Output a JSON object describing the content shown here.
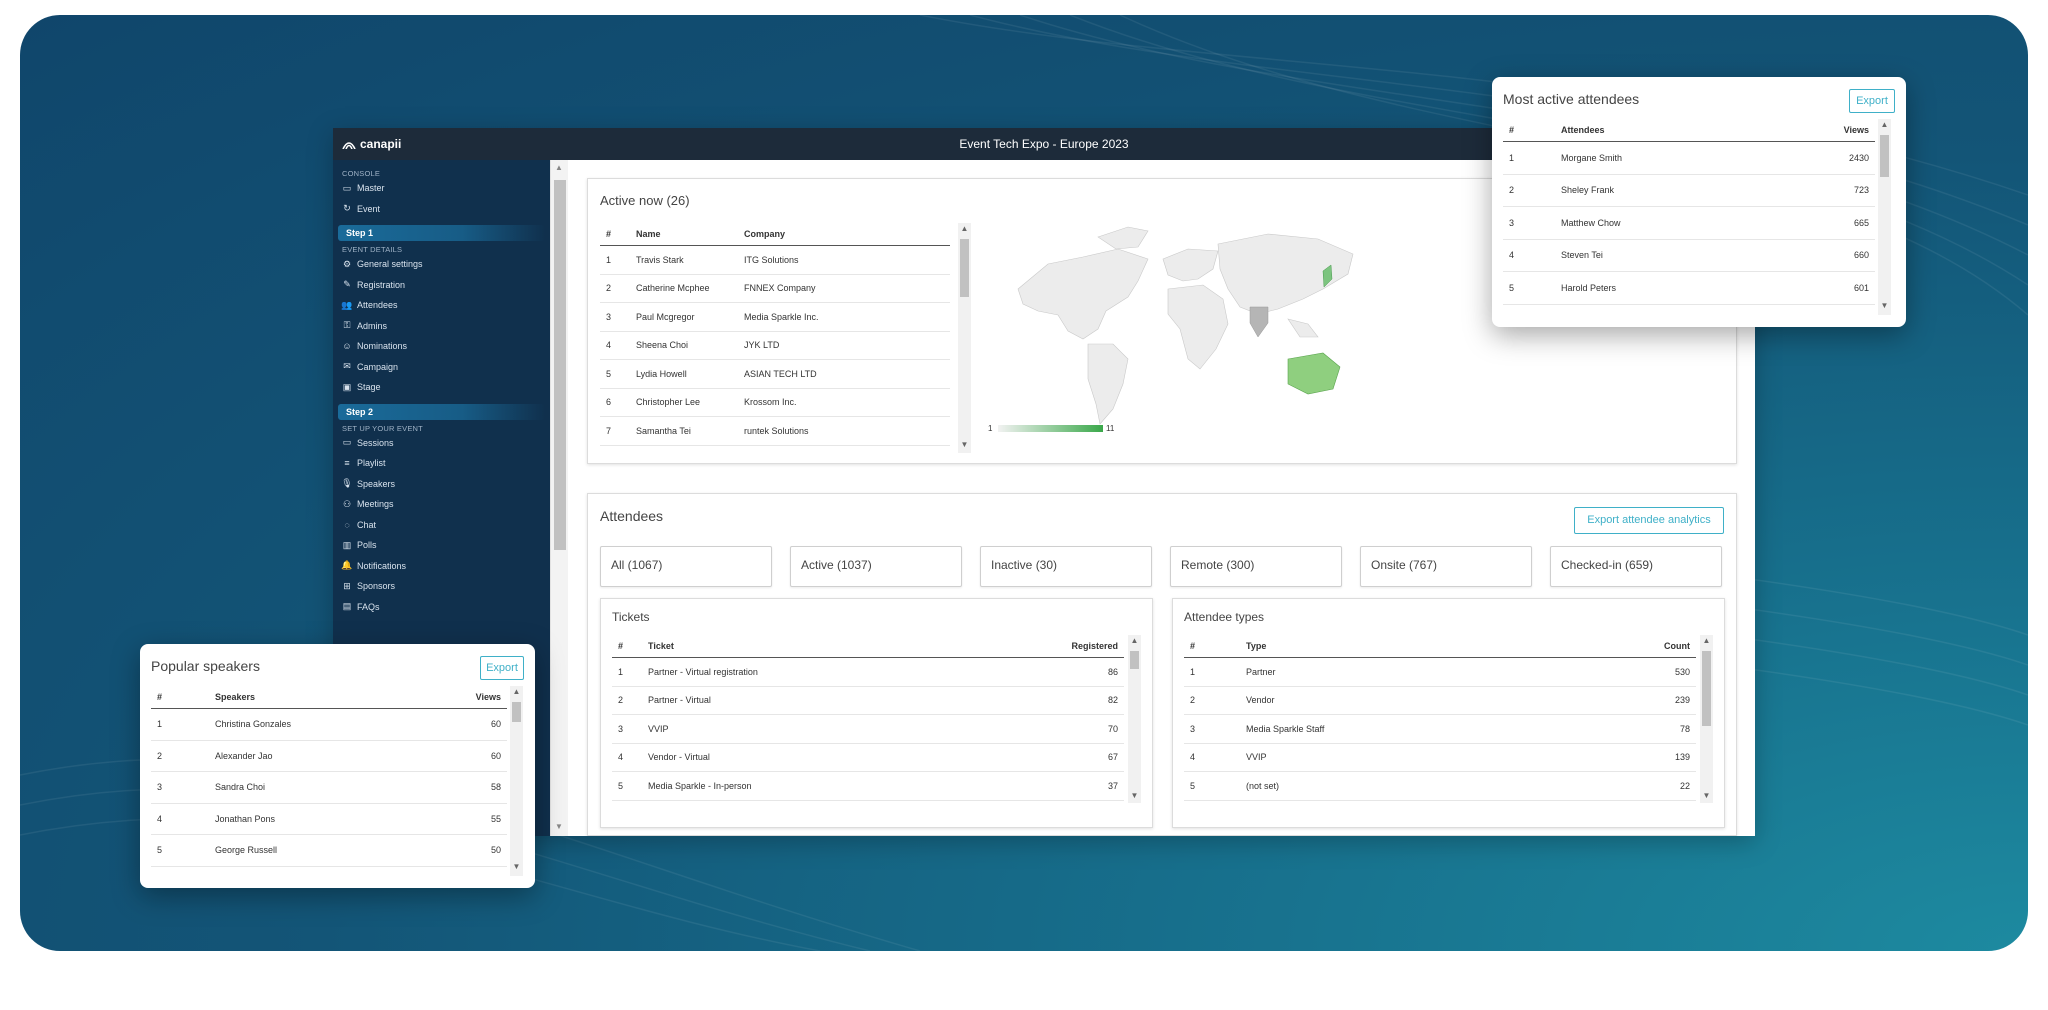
{
  "app": {
    "brand": "canapii",
    "title": "Event Tech Expo - Europe 2023"
  },
  "sidebar": {
    "console_label": "CONSOLE",
    "console_items": [
      {
        "label": "Master",
        "icon": "calendar-icon"
      },
      {
        "label": "Event",
        "icon": "event-icon"
      }
    ],
    "step1": "Step 1",
    "event_details_label": "EVENT DETAILS",
    "step1_items": [
      {
        "label": "General settings",
        "icon": "gear-icon"
      },
      {
        "label": "Registration",
        "icon": "edit-icon"
      },
      {
        "label": "Attendees",
        "icon": "users-icon"
      },
      {
        "label": "Admins",
        "icon": "key-icon"
      },
      {
        "label": "Nominations",
        "icon": "user-check-icon"
      },
      {
        "label": "Campaign",
        "icon": "mail-icon"
      },
      {
        "label": "Stage",
        "icon": "video-icon"
      }
    ],
    "step2": "Step 2",
    "setup_label": "SET UP YOUR EVENT",
    "step2_items": [
      {
        "label": "Sessions",
        "icon": "camera-icon"
      },
      {
        "label": "Playlist",
        "icon": "playlist-icon"
      },
      {
        "label": "Speakers",
        "icon": "mic-icon"
      },
      {
        "label": "Meetings",
        "icon": "people-icon"
      },
      {
        "label": "Chat",
        "icon": "chat-icon"
      },
      {
        "label": "Polls",
        "icon": "bar-chart-icon"
      },
      {
        "label": "Notifications",
        "icon": "bell-icon"
      },
      {
        "label": "Sponsors",
        "icon": "sponsor-icon"
      },
      {
        "label": "FAQs",
        "icon": "faq-icon"
      }
    ]
  },
  "active_now": {
    "title": "Active now (26)",
    "columns": [
      "#",
      "Name",
      "Company"
    ],
    "rows": [
      [
        "1",
        "Travis Stark",
        "ITG Solutions"
      ],
      [
        "2",
        "Catherine Mcphee",
        "FNNEX Company"
      ],
      [
        "3",
        "Paul Mcgregor",
        "Media Sparkle Inc."
      ],
      [
        "4",
        "Sheena Choi",
        "JYK LTD"
      ],
      [
        "5",
        "Lydia Howell",
        "ASIAN TECH LTD"
      ],
      [
        "6",
        "Christopher Lee",
        "Krossom Inc."
      ],
      [
        "7",
        "Samantha Tei",
        "runtek Solutions"
      ]
    ],
    "map_legend_min": "1",
    "map_legend_max": "11"
  },
  "attendees": {
    "title": "Attendees",
    "export_label": "Export attendee analytics",
    "filters": [
      "All (1067)",
      "Active (1037)",
      "Inactive (30)",
      "Remote (300)",
      "Onsite (767)",
      "Checked-in (659)"
    ],
    "tickets": {
      "title": "Tickets",
      "columns": [
        "#",
        "Ticket",
        "Registered"
      ],
      "rows": [
        [
          "1",
          "Partner - Virtual registration",
          "86"
        ],
        [
          "2",
          "Partner - Virtual",
          "82"
        ],
        [
          "3",
          "VVIP",
          "70"
        ],
        [
          "4",
          "Vendor - Virtual",
          "67"
        ],
        [
          "5",
          "Media Sparkle - In-person",
          "37"
        ]
      ]
    },
    "types": {
      "title": "Attendee types",
      "columns": [
        "#",
        "Type",
        "Count"
      ],
      "rows": [
        [
          "1",
          "Partner",
          "530"
        ],
        [
          "2",
          "Vendor",
          "239"
        ],
        [
          "3",
          "Media Sparkle Staff",
          "78"
        ],
        [
          "4",
          "VVIP",
          "139"
        ],
        [
          "5",
          "(not set)",
          "22"
        ]
      ]
    }
  },
  "most_active": {
    "title": "Most active attendees",
    "export_label": "Export",
    "columns": [
      "#",
      "Attendees",
      "Views"
    ],
    "rows": [
      [
        "1",
        "Morgane Smith",
        "2430"
      ],
      [
        "2",
        "Sheley Frank",
        "723"
      ],
      [
        "3",
        "Matthew Chow",
        "665"
      ],
      [
        "4",
        "Steven Tei",
        "660"
      ],
      [
        "5",
        "Harold Peters",
        "601"
      ]
    ]
  },
  "popular_speakers": {
    "title": "Popular speakers",
    "export_label": "Export",
    "columns": [
      "#",
      "Speakers",
      "Views"
    ],
    "rows": [
      [
        "1",
        "Christina Gonzales",
        "60"
      ],
      [
        "2",
        "Alexander Jao",
        "60"
      ],
      [
        "3",
        "Sandra Choi",
        "58"
      ],
      [
        "4",
        "Jonathan Pons",
        "55"
      ],
      [
        "5",
        "George Russell",
        "50"
      ]
    ]
  },
  "colors": {
    "accent": "#3fb0c8",
    "sidebar": "#10304d",
    "topbar": "#1d2b3a",
    "map_high": "#3aa84a"
  }
}
